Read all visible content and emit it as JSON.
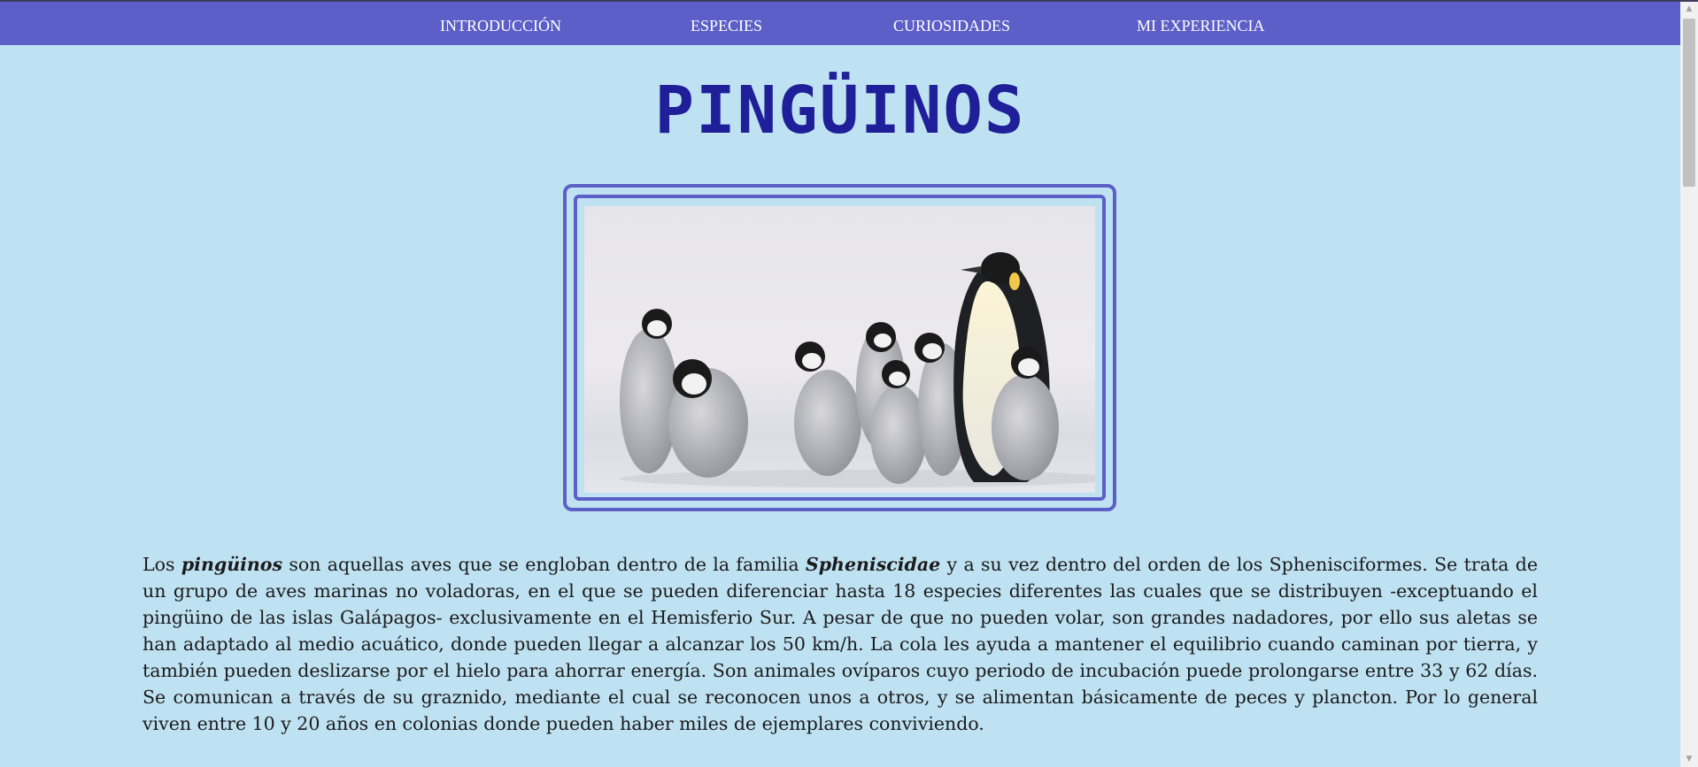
{
  "nav": {
    "items": [
      "INTRODUCCIÓN",
      "ESPECIES",
      "CURIOSIDADES",
      "MI EXPERIENCIA"
    ]
  },
  "page": {
    "title": "PINGÜINOS"
  },
  "hero_image": {
    "subject": "emperor penguin adult with chicks on ice"
  },
  "intro": {
    "t1": "Los ",
    "b1": "pingüinos",
    "t2": " son aquellas aves que se engloban dentro de la familia ",
    "b2": "Spheniscidae",
    "t3": " y a su vez dentro del orden de los Sphenisciformes. Se trata de un grupo de aves marinas no voladoras, en el que se pueden diferenciar hasta 18 especies diferentes las cuales que se distribuyen -exceptuando el pingüino de las islas Galápagos- exclusivamente en el Hemisferio Sur. A pesar de que no pueden volar, son grandes nadadores, por ello sus aletas se han adaptado al medio acuático, donde pueden llegar a alcanzar los 50 km/h. La cola les ayuda a mantener el equilibrio cuando caminan por tierra, y también pueden deslizarse por el hielo para ahorrar energía. Son animales ovíparos cuyo periodo de incubación puede prolongarse entre 33 y 62 días. Se comunican a través de su graznido, mediante el cual se reconocen unos a otros, y se alimentan básicamente de peces y plancton. Por lo general viven entre 10 y 20 años en colonias donde pueden haber miles de ejemplares conviviendo."
  },
  "colors": {
    "background": "#bfe2f2",
    "nav": "#5c5fc7",
    "title": "#1f1f99",
    "frame": "#5c5fc7"
  },
  "icons": {
    "scroll_up": "scroll-up-arrow-icon",
    "scroll_down": "scroll-down-arrow-icon"
  }
}
